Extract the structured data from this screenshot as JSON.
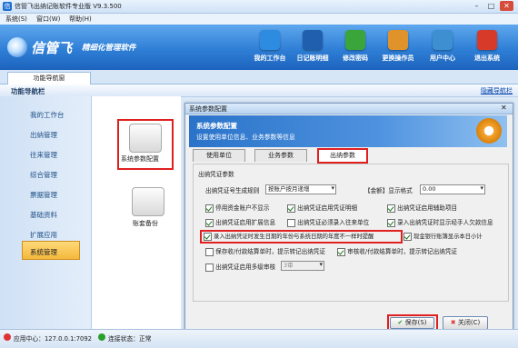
{
  "window": {
    "title": "信管飞出纳记账软件专业版 V9.3.500",
    "app_icon_text": "信"
  },
  "menubar": {
    "items": [
      "系统(S)",
      "窗口(W)",
      "帮助(H)"
    ]
  },
  "banner": {
    "brand": "信管飞",
    "slogan": "精细化管理软件",
    "tools": [
      {
        "label": "我的工作台",
        "icon": "monitor-icon",
        "color": "#2d8be0"
      },
      {
        "label": "日记账明细",
        "icon": "ledger-icon",
        "color": "#1f5fae"
      },
      {
        "label": "修改密码",
        "icon": "key-icon",
        "color": "#3aa53a"
      },
      {
        "label": "更换操作员",
        "icon": "users-icon",
        "color": "#e0932a"
      },
      {
        "label": "用户中心",
        "icon": "user-center-icon",
        "color": "#3c8fd0"
      },
      {
        "label": "退出系统",
        "icon": "power-icon",
        "color": "#d83a2a"
      }
    ]
  },
  "tabs": {
    "nav": "功能导航窗"
  },
  "funcbar": {
    "title": "功能导航栏",
    "hide_link": "隐藏导航栏"
  },
  "sidebar": {
    "items": [
      "我的工作台",
      "出纳管理",
      "往来管理",
      "综合管理",
      "票据管理",
      "基础资料",
      "扩展应用",
      "系统管理"
    ]
  },
  "midpanel": {
    "items": [
      "系统参数配置",
      "账套备份"
    ]
  },
  "dialog": {
    "title": "系统参数配置",
    "header_title": "系统参数配置",
    "header_sub": "设置使用单位信息、业务参数等信息",
    "tabs": [
      "使用单位",
      "业务参数",
      "出纳参数"
    ],
    "group_label": "出纳凭证参数",
    "rule_label": "出纳凭证号生成规则",
    "rule_value": "按账户按月递增",
    "amount_label": "【金额】显示格式",
    "amount_value": "0.00",
    "checks": [
      {
        "label": "停用资金账户不显示",
        "checked": true
      },
      {
        "label": "出纳凭证启用凭证明细",
        "checked": true
      },
      {
        "label": "出纳凭证启用辅助项目",
        "checked": true
      },
      {
        "label": "出纳凭证启用扩展信息",
        "checked": true
      },
      {
        "label": "出纳凭证必须录入往来单位",
        "checked": false
      },
      {
        "label": "录入出纳凭证时显示经手人欠款信息",
        "checked": true
      },
      {
        "label": "录入出纳凭证时发生日期的年份与系统日期的年度不一样时提醒",
        "checked": true
      },
      {
        "label": "现金银行账簿显示本日小计",
        "checked": true
      },
      {
        "label": "保存收/付款结算单时，提示转记出纳凭证",
        "checked": false
      },
      {
        "label": "审核收/付款结算单时，提示转记出纳凭证",
        "checked": true
      },
      {
        "label": "出纳凭证启用多级审核",
        "checked": false
      }
    ],
    "audit_value": "3审",
    "save_label": "保存(S)",
    "close_label": "关闭(C)"
  },
  "status": {
    "app_center": "应用中心：127.0.0.1:7092",
    "connection": "连接状态：正常"
  }
}
